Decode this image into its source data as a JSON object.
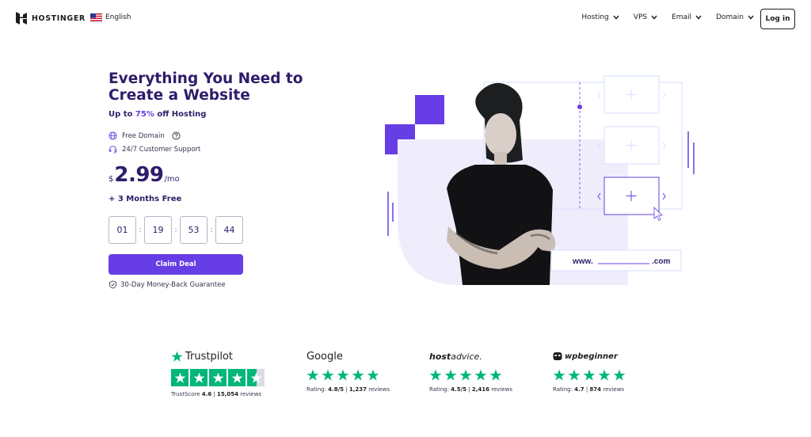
{
  "header": {
    "brand": "HOSTINGER",
    "language": "English",
    "nav": [
      {
        "label": "Hosting"
      },
      {
        "label": "VPS"
      },
      {
        "label": "Email"
      },
      {
        "label": "Domain"
      }
    ],
    "login_label": "Log in"
  },
  "hero": {
    "title_line1": "Everything You Need to",
    "title_line2": "Create a Website",
    "discount_prefix": "Up to ",
    "discount_value": "75%",
    "discount_suffix": " off Hosting",
    "features": [
      {
        "label": "Free Domain",
        "icon": "globe-icon"
      },
      {
        "label": "24/7 Customer Support",
        "icon": "headset-icon"
      }
    ],
    "price_currency": "$",
    "price_amount": "2.99",
    "price_period": "/mo",
    "bonus": "+ 3 Months Free",
    "timer": [
      "01",
      "19",
      "53",
      "44"
    ],
    "claim_label": "Claim Deal",
    "guarantee": "30-Day Money-Back Guarantee",
    "domain_prefix": "www.",
    "domain_suffix": ".com"
  },
  "reviews": [
    {
      "brand": "Trustpilot",
      "label": "TrustScore",
      "score": "4.6",
      "sep": "|",
      "count": "15,054",
      "count_label": "reviews"
    },
    {
      "brand": "Google",
      "label": "Rating:",
      "score": "4.8/5",
      "sep": "|",
      "count": "1,237",
      "count_label": "reviews"
    },
    {
      "brand_a": "host",
      "brand_b": "advice.",
      "label": "Rating:",
      "score": "4.5/5",
      "sep": "|",
      "count": "2,416",
      "count_label": "reviews"
    },
    {
      "brand": "wpbeginner",
      "label": "Rating:",
      "score": "4.7",
      "sep": "|",
      "count": "874",
      "count_label": "reviews"
    }
  ],
  "colors": {
    "accent": "#673de6",
    "dark": "#2f1c6a",
    "star_green": "#00b67a"
  }
}
